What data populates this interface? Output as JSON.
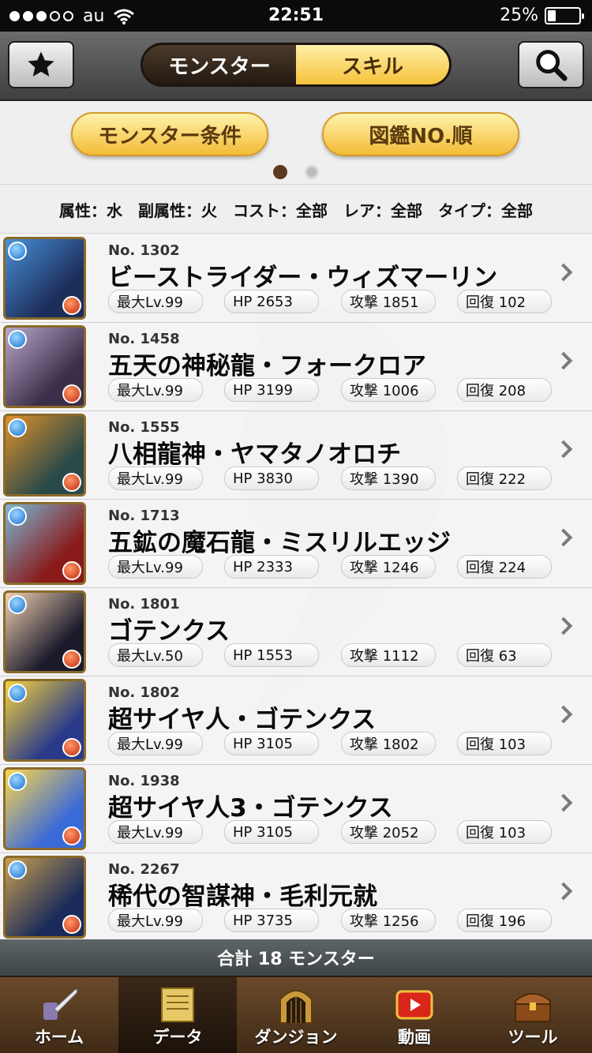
{
  "status_bar": {
    "carrier": "au",
    "time": "22:51",
    "battery": "25%",
    "battery_level": 0.25
  },
  "header": {
    "segments": [
      "モンスター",
      "スキル"
    ],
    "active_segment": 0
  },
  "filters": {
    "monster_condition": "モンスター条件",
    "sort_order": "図鑑NO.順",
    "page_count": 2,
    "current_page": 0
  },
  "summary": {
    "attribute": "属性：水",
    "sub_attribute": "副属性：火",
    "cost": "コスト：全部",
    "rarity": "レア：全部",
    "type": "タイプ：全部"
  },
  "monsters": [
    {
      "no": "No. 1302",
      "name": "ビーストライダー・ウィズマーリン",
      "level": "最大Lv.99",
      "hp": "HP 2653",
      "atk": "攻撃 1851",
      "rcv": "回復 102",
      "color1": "#4a8fd8",
      "color2": "#1c2e5a"
    },
    {
      "no": "No. 1458",
      "name": "五天の神秘龍・フォークロア",
      "level": "最大Lv.99",
      "hp": "HP 3199",
      "atk": "攻撃 1006",
      "rcv": "回復 208",
      "color1": "#b8a8c8",
      "color2": "#3a2e4a"
    },
    {
      "no": "No. 1555",
      "name": "八相龍神・ヤマタノオロチ",
      "level": "最大Lv.99",
      "hp": "HP 3830",
      "atk": "攻撃 1390",
      "rcv": "回復 222",
      "color1": "#e0902a",
      "color2": "#2a4a4a"
    },
    {
      "no": "No. 1713",
      "name": "五鉱の魔石龍・ミスリルエッジ",
      "level": "最大Lv.99",
      "hp": "HP 2333",
      "atk": "攻撃 1246",
      "rcv": "回復 224",
      "color1": "#7ab8d8",
      "color2": "#8a1a1a"
    },
    {
      "no": "No. 1801",
      "name": "ゴテンクス",
      "level": "最大Lv.50",
      "hp": "HP 1553",
      "atk": "攻撃 1112",
      "rcv": "回復 63",
      "color1": "#f0d0b0",
      "color2": "#1a1a2a"
    },
    {
      "no": "No. 1802",
      "name": "超サイヤ人・ゴテンクス",
      "level": "最大Lv.99",
      "hp": "HP 3105",
      "atk": "攻撃 1802",
      "rcv": "回復 103",
      "color1": "#f6d43a",
      "color2": "#2a3a8a"
    },
    {
      "no": "No. 1938",
      "name": "超サイヤ人3・ゴテンクス",
      "level": "最大Lv.99",
      "hp": "HP 3105",
      "atk": "攻撃 2052",
      "rcv": "回復 103",
      "color1": "#ffd84a",
      "color2": "#3a6ad8"
    },
    {
      "no": "No. 2267",
      "name": "稀代の智謀神・毛利元就",
      "level": "最大Lv.99",
      "hp": "HP 3735",
      "atk": "攻撃 1256",
      "rcv": "回復 196",
      "color1": "#c8a050",
      "color2": "#1a2a5a"
    }
  ],
  "total": "合計 18 モンスター",
  "tabbar": {
    "tabs": [
      {
        "label": "ホーム",
        "icon": "quill-icon"
      },
      {
        "label": "データ",
        "icon": "document-icon"
      },
      {
        "label": "ダンジョン",
        "icon": "dungeon-gate-icon"
      },
      {
        "label": "動画",
        "icon": "play-icon"
      },
      {
        "label": "ツール",
        "icon": "treasure-chest-icon"
      }
    ],
    "active_tab": 1
  }
}
